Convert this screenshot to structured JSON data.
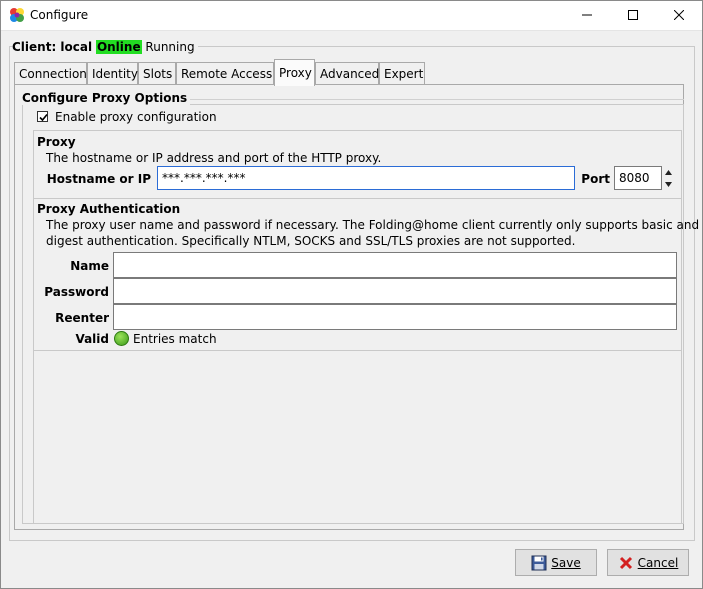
{
  "window": {
    "title": "Configure",
    "app_icon": "folding-at-home-icon"
  },
  "client": {
    "label": "Client: local",
    "status": "Online",
    "state": "Running",
    "status_color": "#22dd22"
  },
  "tabs": [
    {
      "label": "Connection"
    },
    {
      "label": "Identity"
    },
    {
      "label": "Slots"
    },
    {
      "label": "Remote Access"
    },
    {
      "label": "Proxy",
      "active": true
    },
    {
      "label": "Advanced"
    },
    {
      "label": "Expert"
    }
  ],
  "proxy_options": {
    "group_title": "Configure Proxy Options",
    "enable_label": "Enable proxy configuration",
    "enable_checked": true
  },
  "proxy": {
    "title": "Proxy",
    "description": "The hostname or IP address and port of the HTTP proxy.",
    "hostname_label": "Hostname or IP",
    "hostname_value": "***.***.***.***",
    "port_label": "Port",
    "port_value": "8080"
  },
  "auth": {
    "title": "Proxy Authentication",
    "description_line1": "The proxy user name and password if necessary.  The Folding@home client currently only supports basic and",
    "description_line2": "digest authentication.  Specifically NTLM, SOCKS and SSL/TLS proxies are not supported.",
    "name_label": "Name",
    "name_value": "",
    "password_label": "Password",
    "password_value": "",
    "reenter_label": "Reenter",
    "reenter_value": "",
    "valid_label": "Valid",
    "valid_text": "Entries match",
    "valid_color": "#4caf26"
  },
  "buttons": {
    "save": "Save",
    "cancel": "Cancel"
  }
}
